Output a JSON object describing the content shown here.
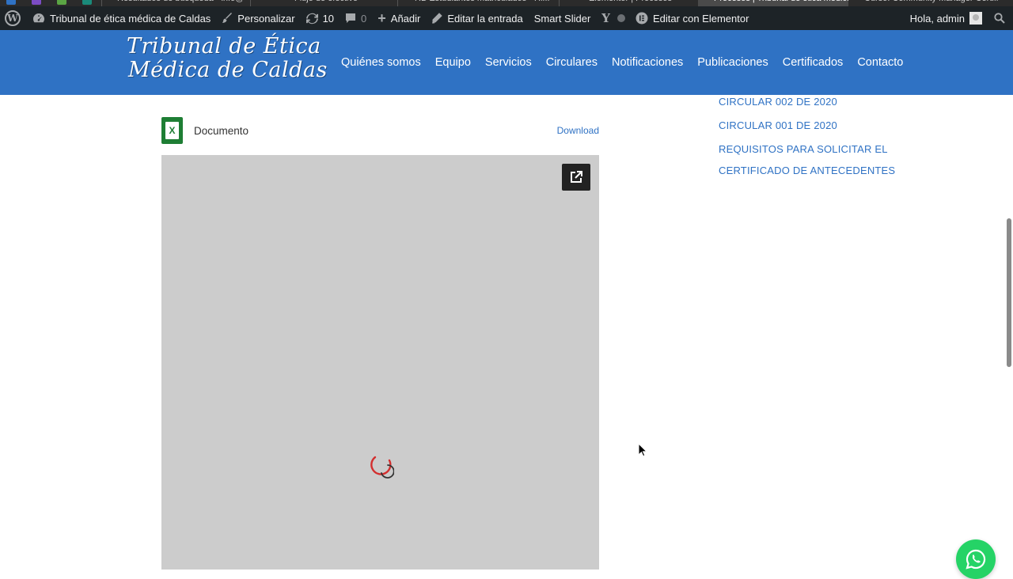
{
  "browser_tabs": [
    {
      "label": "Resultados de búsqueda - info@t..."
    },
    {
      "label": "Flujo de efectivo"
    },
    {
      "label": "RB Estudiantes matriculados - Hi..."
    },
    {
      "label": "Elementor | Procesos"
    },
    {
      "label": "Procesos | Tribunal de ética médica..."
    },
    {
      "label": "Curso: Community Manager Certifi..."
    }
  ],
  "admin_bar": {
    "site_name": "Tribunal de ética médica de Caldas",
    "customize": "Personalizar",
    "updates_count": "10",
    "comments_count": "0",
    "add_new": "Añadir",
    "edit_post": "Editar la entrada",
    "smart_slider": "Smart Slider",
    "edit_elementor": "Editar con Elementor",
    "greeting": "Hola, admin"
  },
  "header": {
    "logo_line1": "Tribunal de Ética",
    "logo_line2": "Médica de Caldas",
    "nav": [
      "Quiénes somos",
      "Equipo",
      "Servicios",
      "Circulares",
      "Notificaciones",
      "Publicaciones",
      "Certificados",
      "Contacto"
    ]
  },
  "document": {
    "icon_letter": "X",
    "title": "Documento",
    "download": "Download"
  },
  "sidebar": {
    "links": [
      "CIRCULAR 002 DE 2020",
      "CIRCULAR 001 DE 2020",
      "REQUISITOS PARA SOLICITAR EL",
      "CERTIFICADO DE ANTECEDENTES"
    ]
  },
  "colors": {
    "header_bg": "#2f72c4",
    "admin_bar_bg": "#1d2327",
    "viewer_bg": "#cccccc",
    "link": "#2f72c4",
    "whatsapp": "#25d366",
    "excel_green": "#1e7e34"
  }
}
